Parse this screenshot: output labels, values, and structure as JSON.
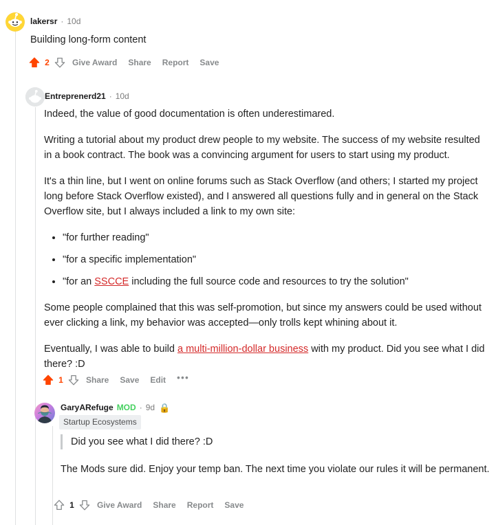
{
  "theme": {
    "upvote_active": "#ff4500",
    "arrow_inactive": "#878a8c",
    "link_color": "#d42929",
    "mod_color": "#46d160",
    "meta_color": "#7c7c7c",
    "threadline_color": "#dfe0e1",
    "flair_bg": "#edeff1"
  },
  "comments": [
    {
      "id": "comment-lakersr",
      "author": "lakersr",
      "separator": "·",
      "age": "10d",
      "avatar_icon": "snoo-avatar-yellow",
      "body_paragraphs": [
        "Building long-form content"
      ],
      "score": "2",
      "upvoted": true,
      "upvote_icon": "upvote-arrow-filled",
      "downvote_icon": "downvote-arrow-outline",
      "actions": [
        "Give Award",
        "Share",
        "Report",
        "Save"
      ]
    },
    {
      "id": "comment-entreprenerd21",
      "author": "Entreprenerd21",
      "separator": "·",
      "age": "10d",
      "avatar_icon": "snoo-avatar-gray",
      "paragraph_1": "Indeed, the value of good documentation is often underestimared.",
      "paragraph_2": "Writing a tutorial about my product drew people to my website. The success of my website resulted in a book contract. The book was a convincing argument for users to start using my product.",
      "paragraph_3": "It's a thin line, but I went on online forums such as Stack Overflow (and others; I started my project long before Stack Overflow existed), and I answered all questions fully and in general on the Stack Overflow site, but I always included a link to my own site:",
      "bullets": [
        {
          "text": "\"for further reading\""
        },
        {
          "text": "\"for a specific implementation\""
        },
        {
          "prefix": "\"for an ",
          "link": "SSCCE",
          "suffix": " including the full source code and resources to try the solution\""
        }
      ],
      "paragraph_4": "Some people complained that this was self-promotion, but since my answers could be used without ever clicking a link, my behavior was accepted—only trolls kept whining about it.",
      "paragraph_5_prefix": "Eventually, I was able to build ",
      "paragraph_5_link": "a multi-million-dollar business",
      "paragraph_5_suffix": " with my product. Did you see what I did there? :D",
      "score": "1",
      "upvoted": true,
      "upvote_icon": "upvote-arrow-filled",
      "downvote_icon": "downvote-arrow-outline",
      "actions": [
        "Share",
        "Save",
        "Edit"
      ],
      "overflow_icon": "more-options-ellipsis"
    },
    {
      "id": "comment-garyarefuge",
      "author": "GaryARefuge",
      "mod_badge": "MOD",
      "separator": "·",
      "age": "9d",
      "lock_icon": "🔒",
      "lock_icon_name": "locked-icon",
      "avatar_icon": "photo-avatar-masked-person",
      "flair": "Startup Ecosystems",
      "quote": "Did you see what I did there? :D",
      "paragraph_1": "The Mods sure did. Enjoy your temp ban. The next time you violate our rules it will be permanent.",
      "score": "1",
      "upvoted": false,
      "upvote_icon": "upvote-arrow-outline",
      "downvote_icon": "downvote-arrow-outline",
      "actions": [
        "Give Award",
        "Share",
        "Report",
        "Save"
      ]
    }
  ]
}
